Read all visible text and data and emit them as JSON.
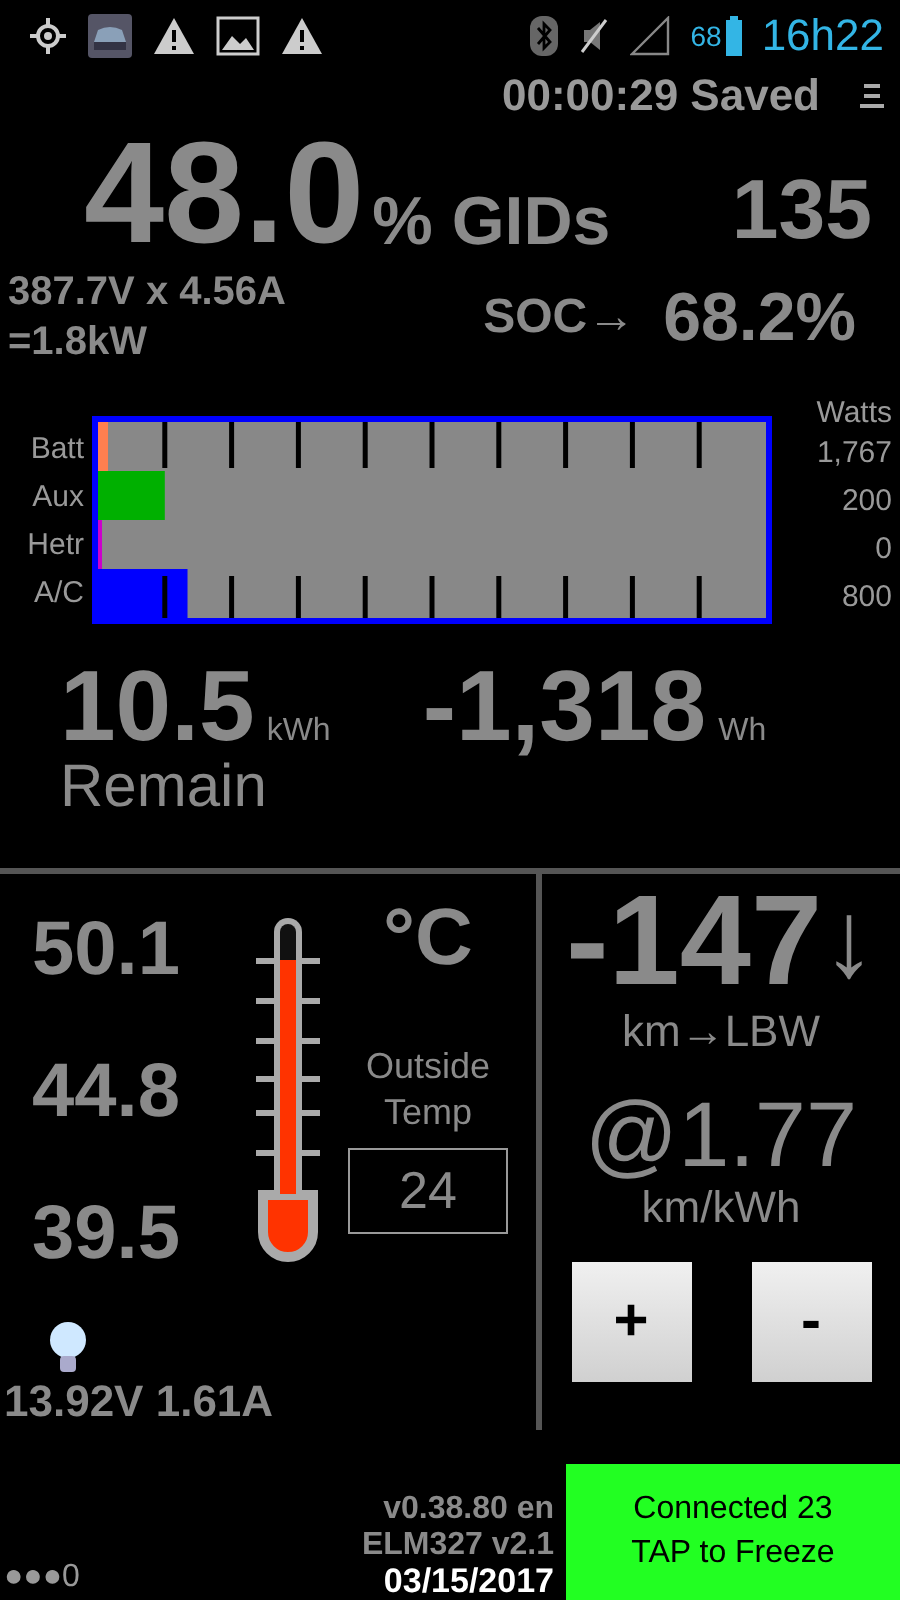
{
  "status_bar": {
    "battery_percent": "68",
    "time": "16h22"
  },
  "header": {
    "timer": "00:00:29 Saved"
  },
  "charge": {
    "percent": "48.0",
    "percent_unit": "% GIDs",
    "gids": "135",
    "power_line_1": "387.7V x 4.56A",
    "power_line_2": "=1.8kW",
    "soc_label": "SOC→",
    "soc": "68.2%"
  },
  "power_bars": {
    "heading": "Watts",
    "rows": [
      {
        "label": "Batt",
        "value": "1,767",
        "level": 0.015,
        "color": "#ff7f50"
      },
      {
        "label": "Aux",
        "value": "200",
        "level": 0.1,
        "color": "#00b000"
      },
      {
        "label": "Hetr",
        "value": "0",
        "level": 0.006,
        "color": "#cc00cc"
      },
      {
        "label": "A/C",
        "value": "800",
        "level": 0.134,
        "color": "#0000ff"
      }
    ]
  },
  "energy": {
    "remain": "10.5",
    "remain_unit": "kWh",
    "remain_label": "Remain",
    "delta": "-1,318",
    "delta_unit": "Wh"
  },
  "temperatures": {
    "readings": [
      "50.1",
      "44.8",
      "39.5"
    ],
    "unit": "°C",
    "thermometer": {
      "level": 0.87
    },
    "outside_label": "Outside Temp",
    "outside_value": "24"
  },
  "range": {
    "distance": "-147",
    "arrow": "↓",
    "destination": "km→LBW",
    "efficiency": "@1.77",
    "efficiency_unit": "km/kWh",
    "buttons": [
      "+",
      "-"
    ]
  },
  "aux_battery": "13.92V 1.61A",
  "footer": {
    "pager": "●●●0",
    "version": "v0.38.80 en",
    "adapter": "ELM327 v2.1",
    "date": "03/15/2017",
    "connection": [
      "Connected 23",
      "TAP to Freeze"
    ]
  }
}
